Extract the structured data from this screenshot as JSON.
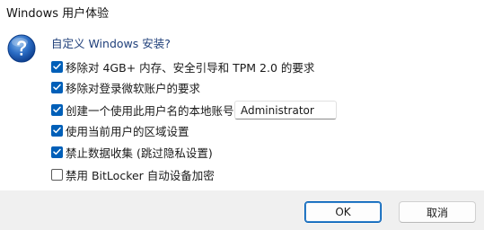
{
  "window": {
    "title": "Windows 用户体验"
  },
  "dialog": {
    "icon": "question-icon",
    "prompt": "自定义 Windows 安装?",
    "options": [
      {
        "label": "移除对 4GB+ 内存、安全引导和 TPM 2.0 的要求",
        "checked": true
      },
      {
        "label": "移除对登录微软账户的要求",
        "checked": true
      },
      {
        "label": "创建一个使用此用户名的本地账号:",
        "checked": true
      },
      {
        "label": "使用当前用户的区域设置",
        "checked": true
      },
      {
        "label": "禁止数据收集 (跳过隐私设置)",
        "checked": true
      },
      {
        "label": "禁用 BitLocker 自动设备加密",
        "checked": false
      }
    ],
    "account_name": "Administrator"
  },
  "buttons": {
    "ok": "OK",
    "cancel": "取消"
  },
  "colors": {
    "accent": "#005fb8",
    "prompt_text": "#1f3f7a",
    "footer_bg": "#f0f0f0"
  }
}
